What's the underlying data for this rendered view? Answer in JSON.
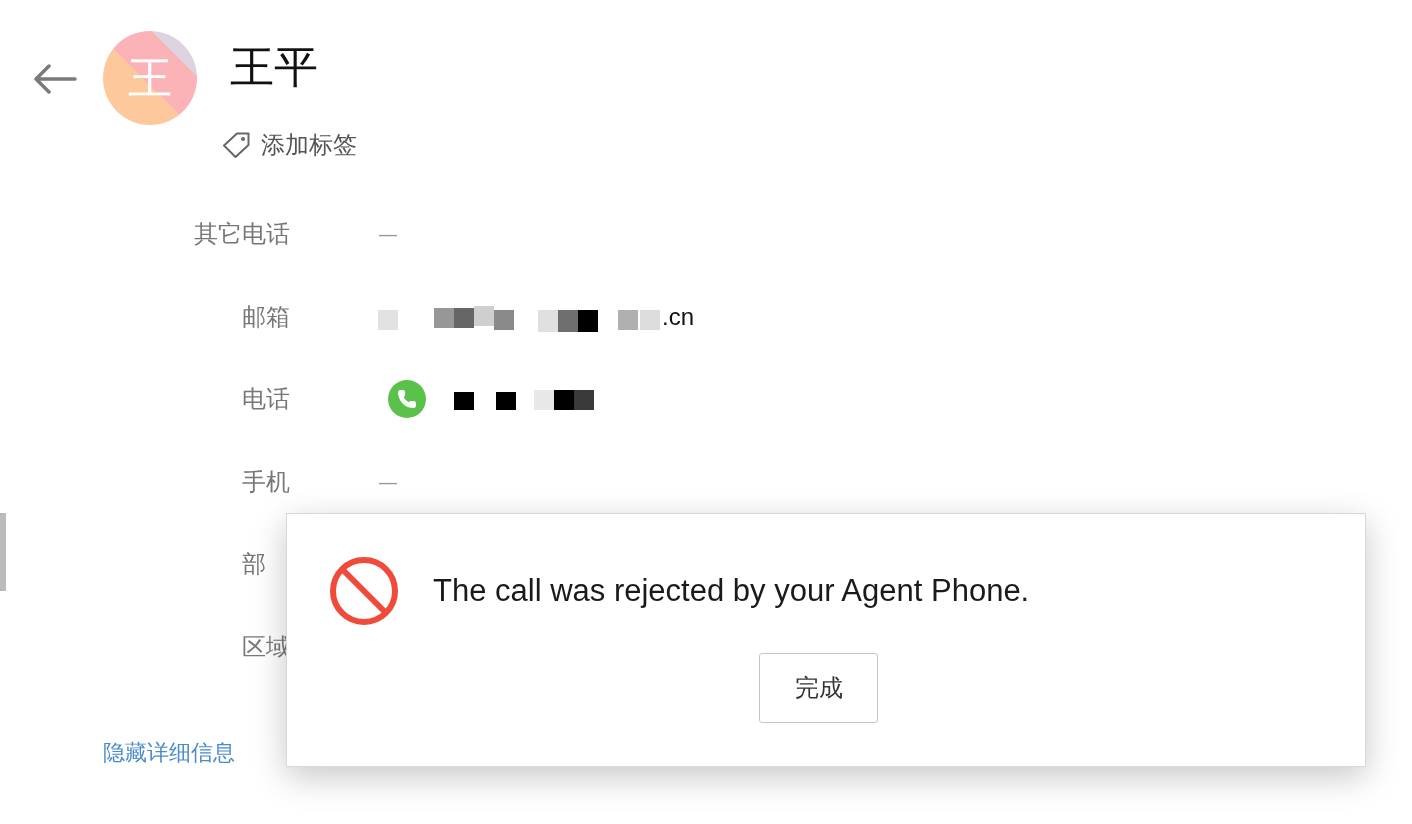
{
  "contact": {
    "avatar_initial": "王",
    "name": "王平",
    "add_tag": "添加标签"
  },
  "details": [
    {
      "label": "其它电话",
      "kind": "empty",
      "value": "—"
    },
    {
      "label": "邮箱",
      "kind": "email",
      "redacted": true,
      "value": ".cn"
    },
    {
      "label": "电话",
      "kind": "phone",
      "redacted": true
    },
    {
      "label": "手机",
      "kind": "empty",
      "value": "—"
    },
    {
      "label": "部",
      "kind": "hidden"
    },
    {
      "label": "区域",
      "kind": "hidden"
    }
  ],
  "footer": {
    "link": "隐藏详细信息"
  },
  "dialog": {
    "message": "The call was rejected by your Agent Phone.",
    "button": "完成"
  }
}
